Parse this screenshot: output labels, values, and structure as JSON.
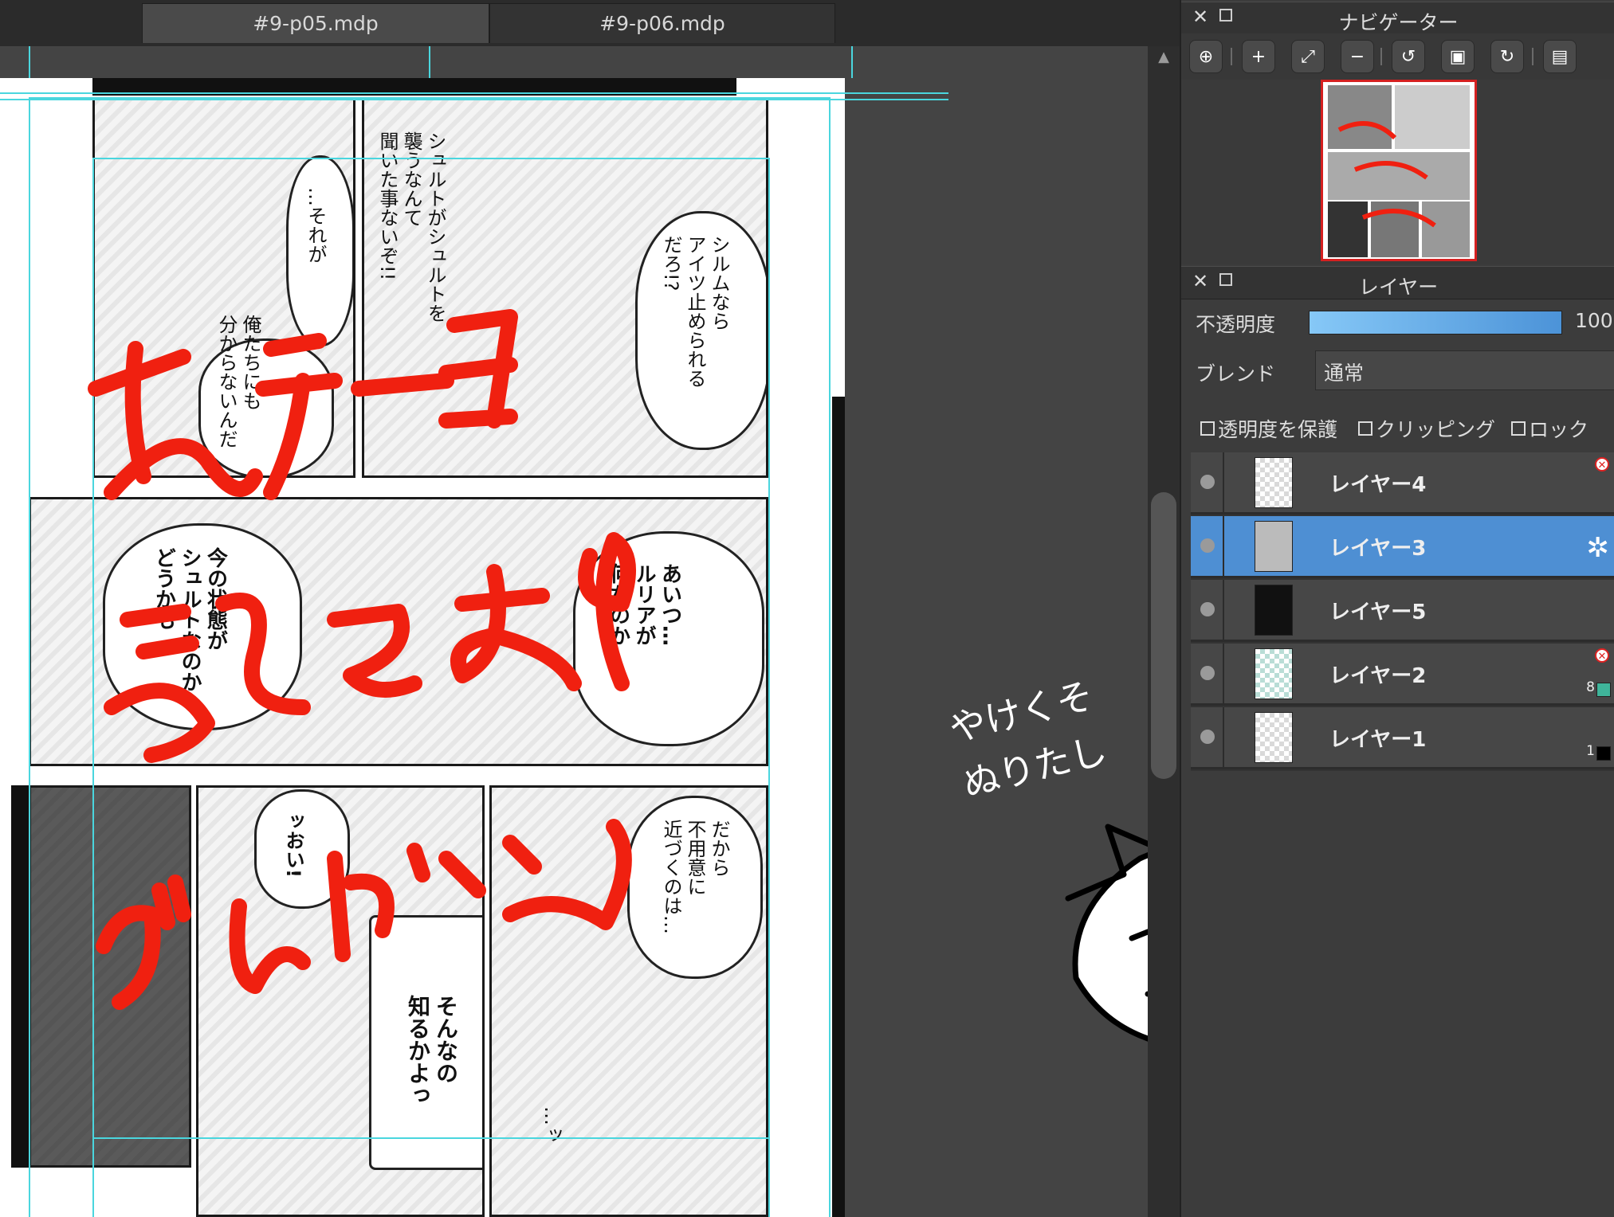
{
  "tabs": [
    {
      "label": "#9-p05.mdp"
    },
    {
      "label": "#9-p06.mdp"
    }
  ],
  "manga": {
    "bubbles": [
      "シュルトがシュルトを\n襲うなんて\n聞いた事ないぞ!!",
      "…それが",
      "俺たちにも\n分からないんだ",
      "シルムなら\nアイツ止められる\nだろ!?",
      "今の状態が\nシュルトなのか\nどうかも",
      "あいつ…\nルリアが\n何なのか",
      "ッおい!",
      "だから\n不用意に\n近づくのは…",
      "そんなの\n知るかよっ",
      "…ッ"
    ],
    "overlay_red": [
      "そデーヨ",
      "そえてます",
      "がんばって"
    ]
  },
  "navigator": {
    "title": "ナビゲーター",
    "tools": [
      "zoom-1to1-icon",
      "zoom-in-icon",
      "fit-icon",
      "zoom-out-icon",
      "rotate-left-icon",
      "fullscreen-icon",
      "rotate-right-icon",
      "lock-icon"
    ]
  },
  "layers": {
    "title": "レイヤー",
    "opacity_label": "不透明度",
    "opacity_value": "100",
    "opacity": 1.0,
    "blend_label": "ブレンド",
    "blend_value": "通常",
    "protect_label": "透明度を保護",
    "clipping_label": "クリッピング",
    "lock_label": "ロック",
    "items": [
      {
        "name": "レイヤー4",
        "selected": false,
        "badge": "✕"
      },
      {
        "name": "レイヤー3",
        "selected": true
      },
      {
        "name": "レイヤー5",
        "selected": false
      },
      {
        "name": "レイヤー2",
        "selected": false,
        "badge": "✕",
        "count": "8",
        "swatch": "#3fb49a"
      },
      {
        "name": "レイヤー1",
        "selected": false,
        "count": "1",
        "swatch": "#000000"
      }
    ]
  },
  "doodle_note": "やけくそ\nぬりたし",
  "colors": {
    "accent": "#4e8fd3",
    "red_ink": "#f02010",
    "guide": "#4ad6de"
  }
}
